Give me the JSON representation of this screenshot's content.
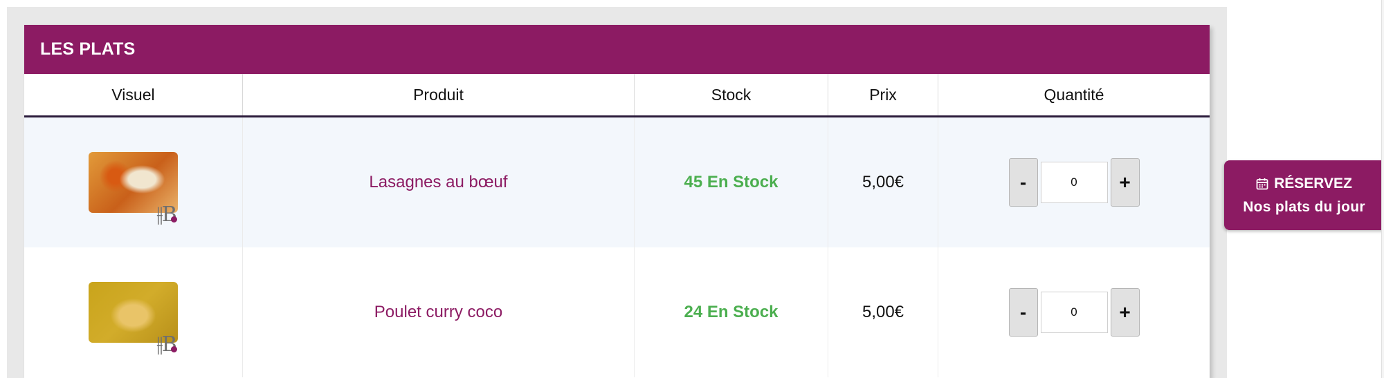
{
  "section": {
    "title": "LES PLATS"
  },
  "table": {
    "headers": [
      "Visuel",
      "Produit",
      "Stock",
      "Prix",
      "Quantité"
    ],
    "rows": [
      {
        "image": "lasagne-photo",
        "logo": "HB",
        "product": "Lasagnes au bœuf",
        "stock": "45 En Stock",
        "price": "5,00€",
        "quantity": "0",
        "minus": "-",
        "plus": "+"
      },
      {
        "image": "curry-chicken-photo",
        "logo": "HB",
        "product": "Poulet curry coco",
        "stock": "24 En Stock",
        "price": "5,00€",
        "quantity": "0",
        "minus": "-",
        "plus": "+"
      }
    ]
  },
  "reserve": {
    "line1": "RÉSERVEZ",
    "line2": "Nos plats du jour",
    "icon": "calendar-icon"
  },
  "colors": {
    "brand": "#8c1b63",
    "stock_green": "#4caf50",
    "row_alt": "#f3f7fc"
  }
}
